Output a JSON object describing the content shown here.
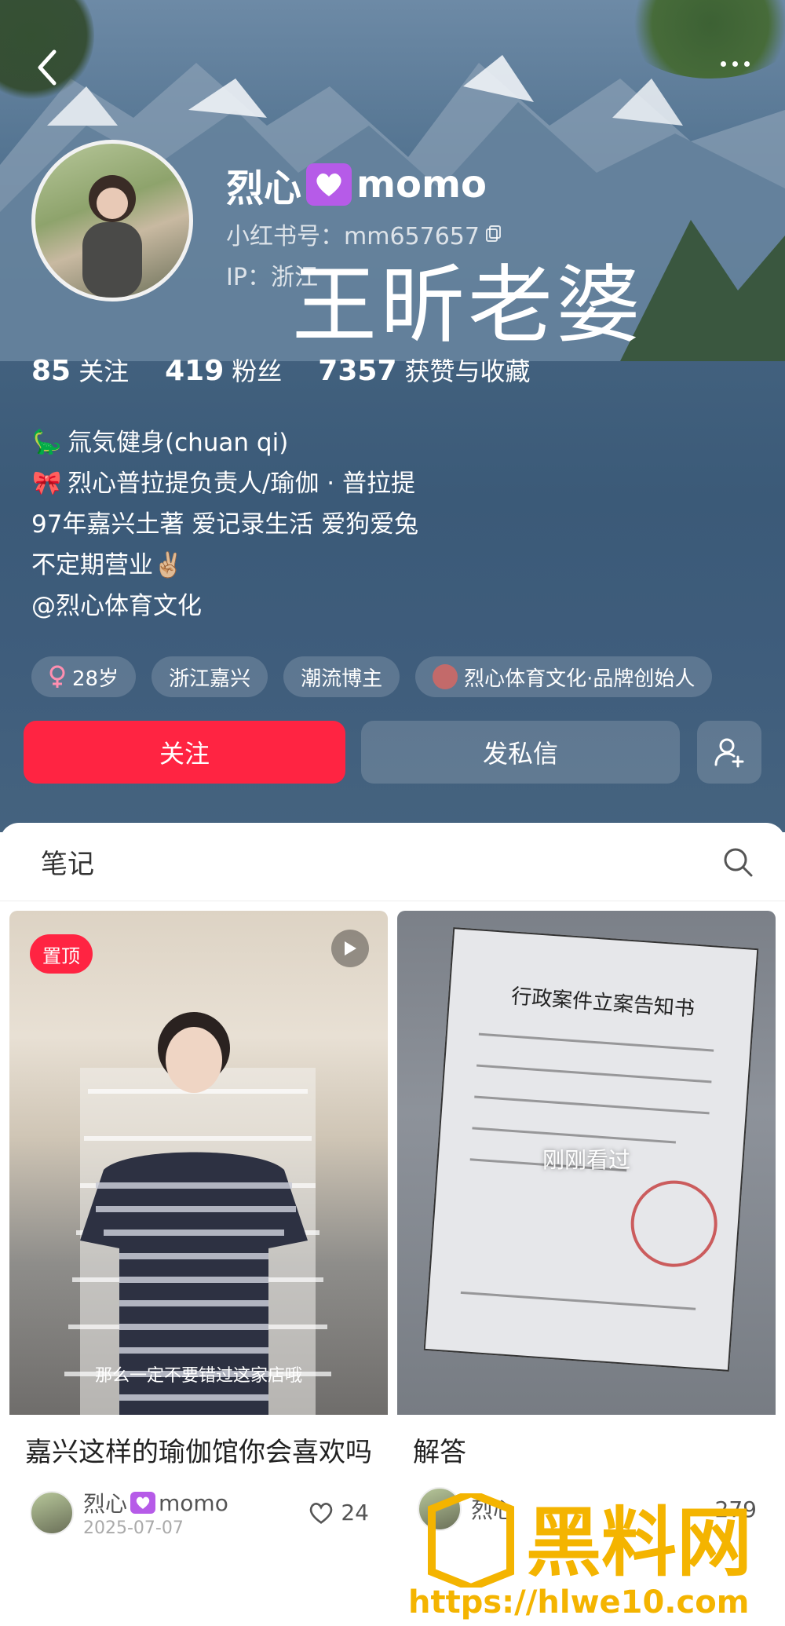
{
  "profile": {
    "nickname_part1": "烈心",
    "nickname_part2": "momo",
    "red_id": "小红书号：mm657657",
    "ip": "IP：浙江",
    "overlay_text": "王昕老婆"
  },
  "stats": [
    {
      "num": "85",
      "label": "关注"
    },
    {
      "num": "419",
      "label": "粉丝"
    },
    {
      "num": "7357",
      "label": "获赞与收藏"
    }
  ],
  "bio": [
    {
      "emoji": "🦕",
      "text": "氚気健身(chuan qi)"
    },
    {
      "emoji": "🎀",
      "text": "烈心普拉提负责人/瑜伽 · 普拉提"
    },
    {
      "emoji": "",
      "text": "97年嘉兴土著 爱记录生活 爱狗爱兔"
    },
    {
      "emoji": "",
      "text": "不定期营业✌🏼"
    },
    {
      "emoji": "",
      "text": "@烈心体育文化"
    }
  ],
  "tags": [
    {
      "icon": "female-icon",
      "label": "28岁"
    },
    {
      "icon": "",
      "label": "浙江嘉兴"
    },
    {
      "icon": "",
      "label": "潮流博主"
    },
    {
      "icon": "brand-logo-icon",
      "label": "烈心体育文化·品牌创始人"
    }
  ],
  "actions": {
    "follow": "关注",
    "message": "发私信"
  },
  "notes": {
    "title": "笔记"
  },
  "cards": [
    {
      "badge": "置顶",
      "subtitle": "那么一定不要错过这家店哦",
      "title": "嘉兴这样的瑜伽馆你会喜欢吗",
      "author": "烈心",
      "author2": "momo",
      "date": "2025-07-07",
      "likes": "24"
    },
    {
      "doc_heading": "行政案件立案告知书",
      "seen": "刚刚看过",
      "title": "解答",
      "author": "烈心",
      "likes": "279"
    }
  ],
  "watermark": {
    "logo": "黑料网",
    "url": "https://hlwe10.com"
  },
  "colors": {
    "accent": "#ff2442",
    "badge_purple": "#b65be8",
    "watermark_gold": "#f4b400"
  }
}
